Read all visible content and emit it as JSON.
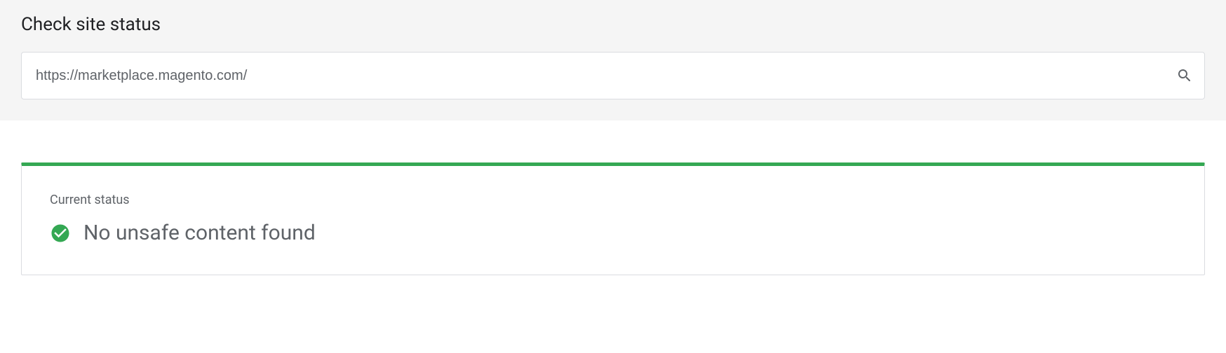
{
  "header": {
    "title": "Check site status"
  },
  "search": {
    "value": "https://marketplace.magento.com/",
    "placeholder": ""
  },
  "status": {
    "label": "Current status",
    "message": "No unsafe content found",
    "accent_color": "#34a853"
  }
}
